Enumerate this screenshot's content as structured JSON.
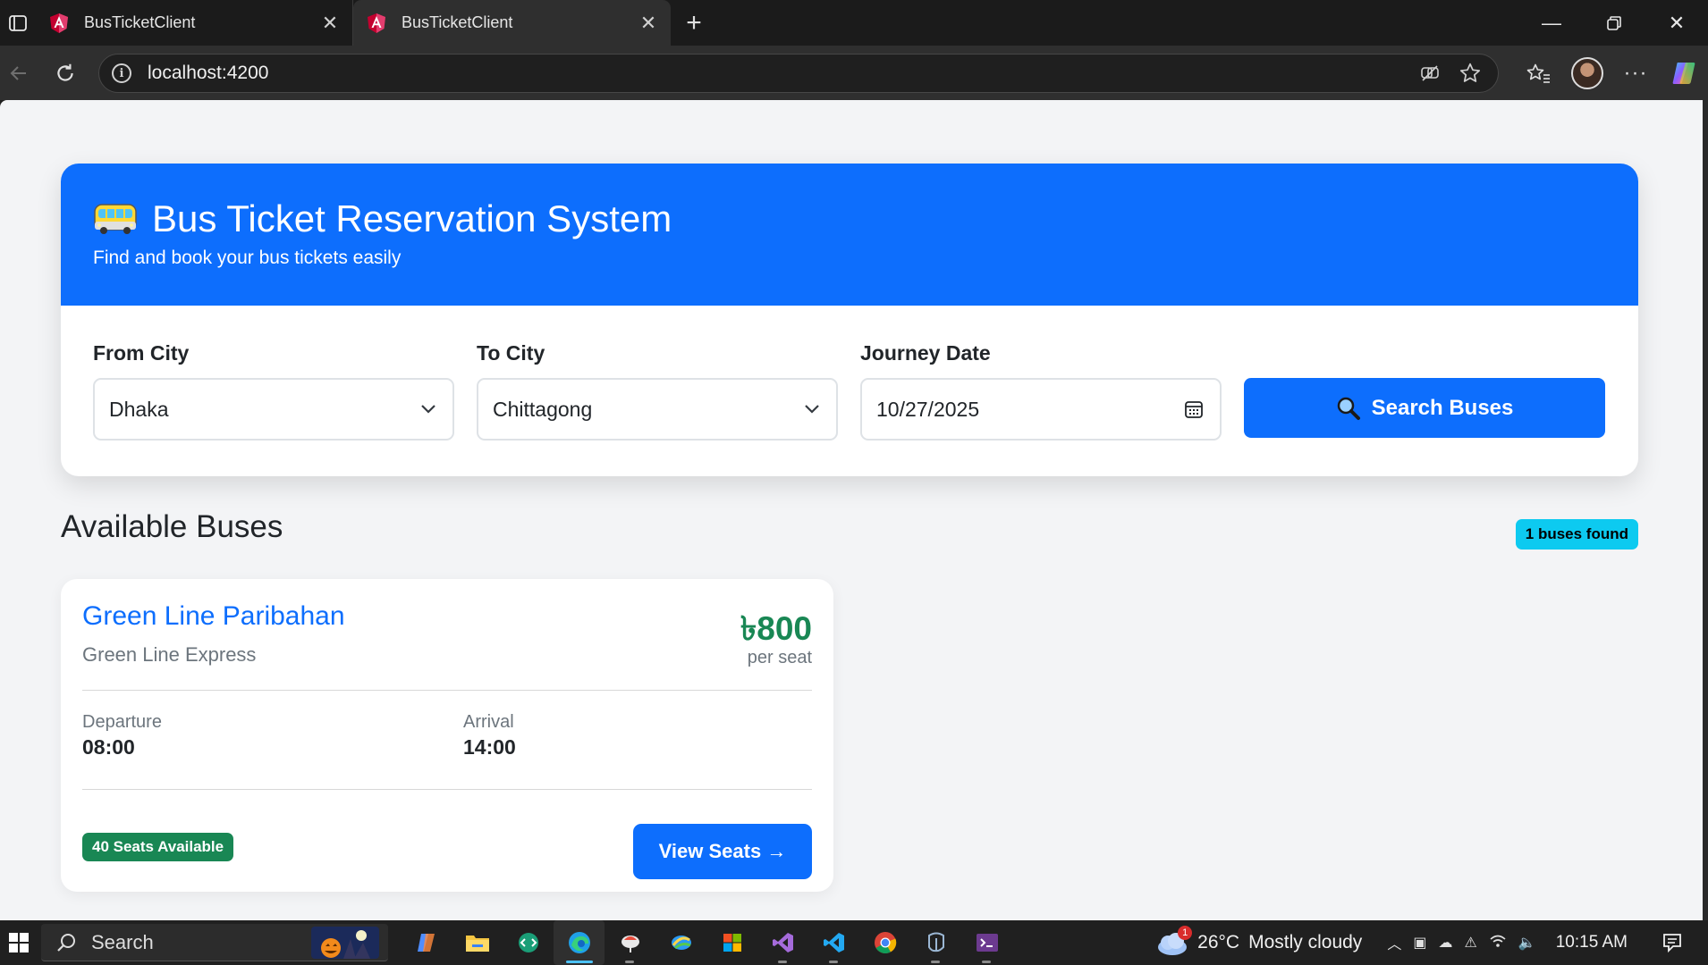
{
  "browser": {
    "tabs": [
      {
        "title": "BusTicketClient",
        "active": false
      },
      {
        "title": "BusTicketClient",
        "active": true
      }
    ],
    "url": "localhost:4200"
  },
  "header": {
    "title": "Bus Ticket Reservation System",
    "subtitle": "Find and book your bus tickets easily"
  },
  "search": {
    "from_label": "From City",
    "from_value": "Dhaka",
    "to_label": "To City",
    "to_value": "Chittagong",
    "date_label": "Journey Date",
    "date_value": "10/27/2025",
    "button_label": "Search Buses"
  },
  "results": {
    "title": "Available Buses",
    "count_badge": "1 buses found",
    "buses": [
      {
        "operator": "Green Line Paribahan",
        "bus_name": "Green Line Express",
        "price": "৳800",
        "price_unit": "per seat",
        "departure_label": "Departure",
        "departure_time": "08:00",
        "arrival_label": "Arrival",
        "arrival_time": "14:00",
        "seats": "40 Seats Available",
        "button_label": "View Seats →"
      }
    ]
  },
  "taskbar": {
    "search_placeholder": "Search",
    "weather_temp": "26°C",
    "weather_desc": "Mostly cloudy",
    "weather_alerts": "1",
    "clock": "10:15 AM"
  },
  "colors": {
    "primary": "#0d6efd",
    "success": "#198754",
    "info": "#0dcaf0"
  }
}
